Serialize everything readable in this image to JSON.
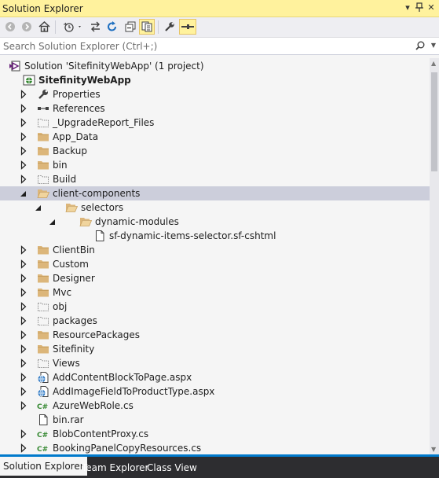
{
  "window": {
    "title": "Solution Explorer",
    "pin_glyph": "▾ ⊥ ✕",
    "colors": {
      "title_bg": "#fff29d",
      "selection": "#cccedb",
      "tab_accent": "#007acc"
    }
  },
  "toolbar": {
    "buttons": [
      "back-icon",
      "forward-icon",
      "home-icon",
      "pending-changes-filter-icon",
      "sync-icon",
      "refresh-icon",
      "collapse-all-icon",
      "show-all-files-icon",
      "properties-icon",
      "preview-icon"
    ]
  },
  "search": {
    "placeholder": "Search Solution Explorer (Ctrl+;)"
  },
  "tree": {
    "items": [
      {
        "label": "Solution 'SitefinityWebApp' (1 project)",
        "icon": "solution-icon",
        "level": 0,
        "expander": "none"
      },
      {
        "label": "SitefinityWebApp",
        "icon": "web-project-icon",
        "level": 0,
        "expander": "expanded",
        "bold": true
      },
      {
        "label": "Properties",
        "icon": "wrench-icon",
        "level": 1,
        "expander": "collapsed"
      },
      {
        "label": "References",
        "icon": "references-icon",
        "level": 1,
        "expander": "collapsed"
      },
      {
        "label": "_UpgradeReport_Files",
        "icon": "folder-excluded-icon",
        "level": 1,
        "expander": "collapsed"
      },
      {
        "label": "App_Data",
        "icon": "folder-icon",
        "level": 1,
        "expander": "collapsed"
      },
      {
        "label": "Backup",
        "icon": "folder-icon",
        "level": 1,
        "expander": "collapsed"
      },
      {
        "label": "bin",
        "icon": "folder-icon",
        "level": 1,
        "expander": "collapsed"
      },
      {
        "label": "Build",
        "icon": "folder-excluded-icon",
        "level": 1,
        "expander": "collapsed"
      },
      {
        "label": "client-components",
        "icon": "folder-open-icon",
        "level": 1,
        "expander": "expanded",
        "selected": true
      },
      {
        "label": "selectors",
        "icon": "folder-open-icon",
        "level": 2,
        "expander": "expanded"
      },
      {
        "label": "dynamic-modules",
        "icon": "folder-open-icon",
        "level": 3,
        "expander": "expanded"
      },
      {
        "label": "sf-dynamic-items-selector.sf-cshtml",
        "icon": "file-icon",
        "level": 4,
        "expander": "none"
      },
      {
        "label": "ClientBin",
        "icon": "folder-icon",
        "level": 1,
        "expander": "collapsed"
      },
      {
        "label": "Custom",
        "icon": "folder-icon",
        "level": 1,
        "expander": "collapsed"
      },
      {
        "label": "Designer",
        "icon": "folder-icon",
        "level": 1,
        "expander": "collapsed"
      },
      {
        "label": "Mvc",
        "icon": "folder-icon",
        "level": 1,
        "expander": "collapsed"
      },
      {
        "label": "obj",
        "icon": "folder-excluded-icon",
        "level": 1,
        "expander": "collapsed"
      },
      {
        "label": "packages",
        "icon": "folder-excluded-icon",
        "level": 1,
        "expander": "collapsed"
      },
      {
        "label": "ResourcePackages",
        "icon": "folder-icon",
        "level": 1,
        "expander": "collapsed"
      },
      {
        "label": "Sitefinity",
        "icon": "folder-icon",
        "level": 1,
        "expander": "collapsed"
      },
      {
        "label": "Views",
        "icon": "folder-excluded-icon",
        "level": 1,
        "expander": "collapsed"
      },
      {
        "label": "AddContentBlockToPage.aspx",
        "icon": "aspx-icon",
        "level": 1,
        "expander": "collapsed"
      },
      {
        "label": "AddImageFieldToProductType.aspx",
        "icon": "aspx-icon",
        "level": 1,
        "expander": "collapsed"
      },
      {
        "label": "AzureWebRole.cs",
        "icon": "csharp-icon",
        "level": 1,
        "expander": "collapsed"
      },
      {
        "label": "bin.rar",
        "icon": "file-icon",
        "level": 1,
        "expander": "none"
      },
      {
        "label": "BlobContentProxy.cs",
        "icon": "csharp-icon",
        "level": 1,
        "expander": "collapsed"
      },
      {
        "label": "BookingPanelCopyResources.cs",
        "icon": "csharp-icon",
        "level": 1,
        "expander": "collapsed"
      }
    ]
  },
  "tabs": [
    {
      "label": "Solution Explorer",
      "active": true
    },
    {
      "label": "Team Explorer",
      "active": false
    },
    {
      "label": "Class View",
      "active": false
    }
  ]
}
